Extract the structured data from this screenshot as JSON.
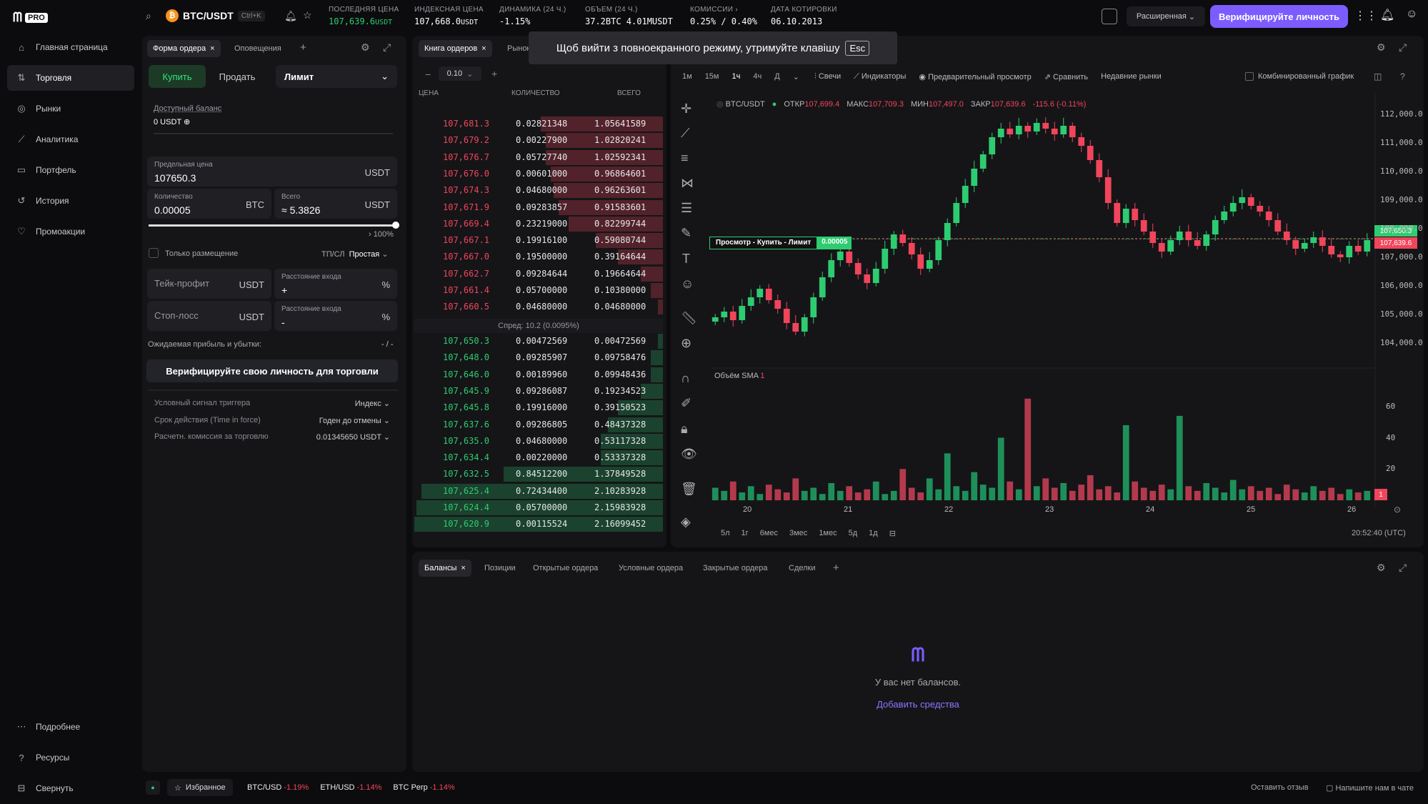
{
  "brand": {
    "name": "m",
    "badge": "PRO"
  },
  "sidebar": {
    "items": [
      {
        "label": "Главная страница",
        "icon": "home-icon"
      },
      {
        "label": "Торговля",
        "icon": "trade-icon"
      },
      {
        "label": "Рынки",
        "icon": "markets-icon"
      },
      {
        "label": "Аналитика",
        "icon": "analytics-icon"
      },
      {
        "label": "Портфель",
        "icon": "portfolio-icon"
      },
      {
        "label": "История",
        "icon": "history-icon"
      },
      {
        "label": "Промоакции",
        "icon": "promo-icon"
      }
    ],
    "bottom": [
      {
        "label": "Подробнее",
        "icon": "more-icon"
      },
      {
        "label": "Ресурсы",
        "icon": "help-icon"
      },
      {
        "label": "Свернуть",
        "icon": "collapse-icon"
      }
    ]
  },
  "topbar": {
    "pair": "BTC/USDT",
    "shortcut": "Ctrl+K",
    "stats": [
      {
        "label": "ПОСЛЕДНЯЯ ЦЕНА",
        "value": "107,639.6",
        "unit": "USDT"
      },
      {
        "label": "ИНДЕКСНАЯ ЦЕНА",
        "value": "107,668.0",
        "unit": "USDT"
      },
      {
        "label": "ДИНАМИКА (24 Ч.)",
        "value": "-1.15%"
      },
      {
        "label": "ОБЪЕМ (24 Ч.)",
        "value": "37.2BTC 4.01MUSDT"
      },
      {
        "label": "КОМИССИИ",
        "value": "0.25% / 0.40%"
      },
      {
        "label": "ДАТА КОТИРОВКИ",
        "value": "06.10.2013"
      }
    ],
    "mode": "Расширенная",
    "verify": "Верифицируйте личность"
  },
  "order_form": {
    "tabs": [
      "Форма ордера",
      "Оповещения"
    ],
    "buy": "Купить",
    "sell": "Продать",
    "type": "Лимит",
    "balance_label": "Доступный баланс",
    "balance_value": "0 USDT",
    "limit_label": "Предельная цена",
    "limit_value": "107650.3",
    "limit_unit": "USDT",
    "qty_label": "Количество",
    "qty_value": "0.00005",
    "qty_unit": "BTC",
    "total_label": "Всего",
    "total_value": "≈ 5.3826",
    "total_unit": "USDT",
    "slider_pct": "100%",
    "slider_fraction": 1.0,
    "post_only": "Только размещение",
    "tpsl_label": "ТП/СЛ",
    "tpsl_value": "Простая",
    "tp_label": "Тейк-профит",
    "sl_label": "Стоп-лосс",
    "tp_unit": "USDT",
    "dist_label": "Расстояние входа",
    "dist_unit": "%",
    "tp_sign": "+",
    "sl_sign": "-",
    "pnl_label": "Ожидаемая прибыль и убытки:",
    "pnl_value": "- / -",
    "verify_btn": "Верифицируйте свою личность для торговли",
    "options": [
      {
        "label": "Условный сигнал триггера",
        "value": "Индекс"
      },
      {
        "label": "Срок действия (Time in force)",
        "value": "Годен до отмены"
      },
      {
        "label": "Расчетн. комиссия за торговлю",
        "value": "0.01345650 USDT"
      }
    ]
  },
  "orderbook": {
    "tabs": [
      "Книга ордеров",
      "Рынок"
    ],
    "step": "0.10",
    "headers": [
      "ЦЕНА",
      "КОЛИЧЕСТВО",
      "ВСЕГО"
    ],
    "asks": [
      [
        "107,681.3",
        "0.02821348",
        "1.05641589",
        0.49
      ],
      [
        "107,679.2",
        "0.00227900",
        "1.02820241",
        0.47
      ],
      [
        "107,676.7",
        "0.05727740",
        "1.02592341",
        0.47
      ],
      [
        "107,676.0",
        "0.00601000",
        "0.96864601",
        0.45
      ],
      [
        "107,674.3",
        "0.04680000",
        "0.96263601",
        0.44
      ],
      [
        "107,671.9",
        "0.09283857",
        "0.91583601",
        0.42
      ],
      [
        "107,669.4",
        "0.23219000",
        "0.82299744",
        0.38
      ],
      [
        "107,667.1",
        "0.19916100",
        "0.59080744",
        0.27
      ],
      [
        "107,667.0",
        "0.19500000",
        "0.39164644",
        0.18
      ],
      [
        "107,662.7",
        "0.09284644",
        "0.19664644",
        0.09
      ],
      [
        "107,661.4",
        "0.05700000",
        "0.10380000",
        0.05
      ],
      [
        "107,660.5",
        "0.04680000",
        "0.04680000",
        0.02
      ]
    ],
    "spread": "Спред: 10.2 (0.0095%)",
    "bids": [
      [
        "107,650.3",
        "0.00472569",
        "0.00472569",
        0.01
      ],
      [
        "107,648.0",
        "0.09285907",
        "0.09758476",
        0.05
      ],
      [
        "107,646.0",
        "0.00189960",
        "0.09948436",
        0.05
      ],
      [
        "107,645.9",
        "0.09286087",
        "0.19234523",
        0.09
      ],
      [
        "107,645.8",
        "0.19916000",
        "0.39150523",
        0.18
      ],
      [
        "107,637.6",
        "0.09286805",
        "0.48437328",
        0.22
      ],
      [
        "107,635.0",
        "0.04680000",
        "0.53117328",
        0.25
      ],
      [
        "107,634.4",
        "0.00220000",
        "0.53337328",
        0.25
      ],
      [
        "107,632.5",
        "0.84512200",
        "1.37849528",
        0.64
      ],
      [
        "107,625.4",
        "0.72434400",
        "2.10283928",
        0.97
      ],
      [
        "107,624.4",
        "0.05700000",
        "2.15983928",
        0.99
      ],
      [
        "107,620.9",
        "0.00115524",
        "2.16099452",
        1.0
      ]
    ]
  },
  "chart": {
    "toast": "Щоб вийти з повноекранного режиму, утримуйте клавішу",
    "toast_key": "Esc",
    "intervals": [
      "1м",
      "15м",
      "1ч",
      "4ч",
      "Д"
    ],
    "toolbar": [
      "Свечи",
      "Индикаторы",
      "Предварительный просмотр",
      "Сравнить",
      "Недавние рынки"
    ],
    "combined": "Комбинированный график",
    "legend": {
      "symbol": "BTC/USDT",
      "o_label": "ОТКР",
      "o": "107,699.4",
      "h_label": "МАКС",
      "h": "107,709.3",
      "l_label": "МИН",
      "l": "107,497.0",
      "c_label": "ЗАКР",
      "c": "107,639.6",
      "chg": "-115.6 (-0.11%)"
    },
    "preview_label": "Просмотр - Купить - Лимит",
    "preview_qty": "0.00005",
    "volume_label": "Объём SMA",
    "volume_badge": "1",
    "price_tag_green": "107,650.3",
    "price_tag_red": "107,639.6",
    "vol_tag": "1",
    "ranges": [
      "5л",
      "1г",
      "6мес",
      "3мес",
      "1мес",
      "5д",
      "1д"
    ],
    "time": "20:52:40 (UTC)"
  },
  "chart_data": {
    "type": "candlestick",
    "x_ticks": [
      "20",
      "21",
      "22",
      "23",
      "24",
      "25",
      "26"
    ],
    "price_ticks": [
      "112,000.0",
      "111,000.0",
      "110,000.0",
      "109,000.0",
      "108,000.0",
      "107,000.0",
      "106,000.0",
      "105,000.0",
      "104,000.0"
    ],
    "ylim": [
      103500,
      112500
    ],
    "volume_ticks": [
      "60",
      "40",
      "20"
    ],
    "volume_ylim": [
      0,
      80
    ],
    "close": [
      104900,
      105100,
      104800,
      105300,
      105600,
      105900,
      105500,
      105200,
      104700,
      104400,
      104900,
      105600,
      106300,
      106900,
      107200,
      106800,
      106400,
      106100,
      106600,
      107300,
      107800,
      107500,
      107100,
      106600,
      106900,
      107600,
      108200,
      108900,
      109500,
      110100,
      110600,
      111200,
      111500,
      111300,
      111600,
      111400,
      111700,
      111500,
      111300,
      111600,
      111200,
      110900,
      110400,
      109800,
      108900,
      108200,
      108700,
      108300,
      107900,
      107500,
      107200,
      107600,
      107900,
      107600,
      107400,
      107800,
      108300,
      108600,
      108900,
      109100,
      108800,
      108600,
      108300,
      107900,
      107600,
      107300,
      107500,
      107700,
      107400,
      107100,
      107000,
      107400,
      107200,
      107600
    ],
    "volume": [
      8,
      6,
      12,
      5,
      9,
      4,
      10,
      7,
      5,
      14,
      6,
      8,
      4,
      11,
      6,
      9,
      5,
      7,
      12,
      4,
      6,
      20,
      8,
      5,
      14,
      7,
      30,
      9,
      6,
      18,
      10,
      8,
      40,
      12,
      7,
      65,
      9,
      14,
      8,
      11,
      6,
      10,
      16,
      7,
      9,
      5,
      48,
      12,
      8,
      6,
      10,
      7,
      54,
      9,
      6,
      11,
      8,
      5,
      13,
      7,
      9,
      6,
      8,
      4,
      10,
      7,
      5,
      9,
      6,
      8,
      4,
      7,
      5,
      6
    ]
  },
  "bottom_panel": {
    "tabs": [
      "Балансы",
      "Позиции",
      "Открытые ордера",
      "Условные ордера",
      "Закрытые ордера",
      "Сделки"
    ],
    "empty": "У вас нет балансов.",
    "add": "Добавить средства"
  },
  "footer": {
    "favorites": "Избранное",
    "tickers": [
      {
        "pair": "BTC/USD",
        "chg": "-1.19%"
      },
      {
        "pair": "ETH/USD",
        "chg": "-1.14%"
      },
      {
        "pair": "BTC Perp",
        "chg": "-1.14%"
      }
    ],
    "feedback": "Оставить отзыв",
    "chat": "Напишите нам в чате"
  }
}
